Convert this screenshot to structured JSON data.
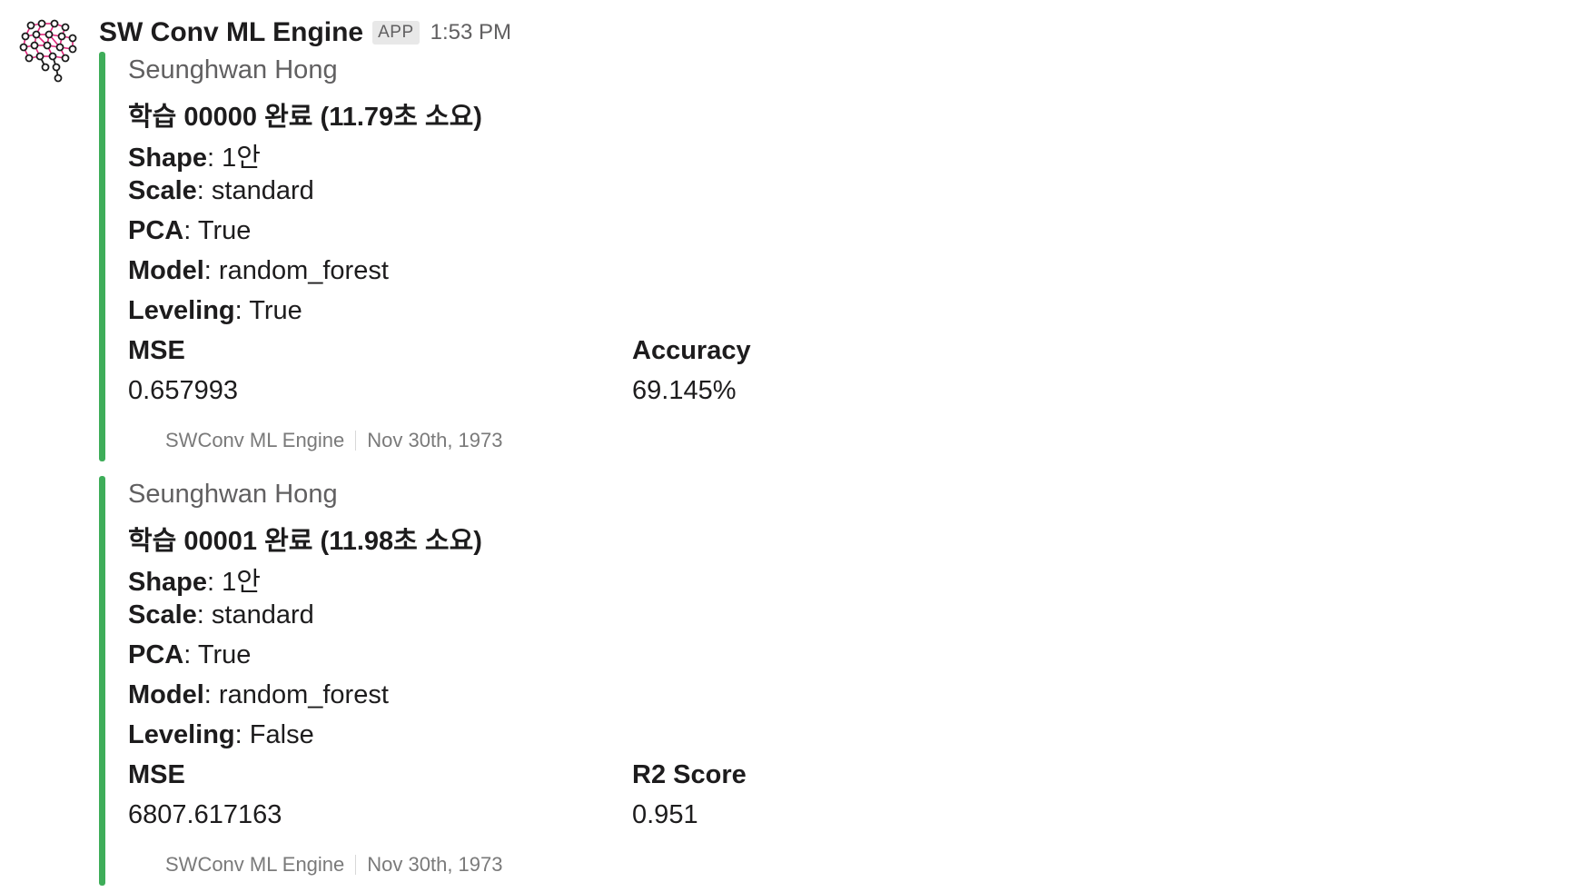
{
  "message": {
    "sender": "SW Conv ML Engine",
    "badge": "APP",
    "time": "1:53 PM",
    "avatar_icon": "neural-network-brain-icon"
  },
  "accent_color": "#3ead59",
  "attachments": [
    {
      "author": "Seunghwan Hong",
      "title": "학습 00000 완료 (11.79초 소요)",
      "fields": [
        {
          "label": "Shape",
          "value": "1안"
        },
        {
          "label": "Scale",
          "value": "standard"
        },
        {
          "label": "PCA",
          "value": "True"
        },
        {
          "label": "Model",
          "value": "random_forest"
        },
        {
          "label": "Leveling",
          "value": "True"
        }
      ],
      "metrics": [
        {
          "label": "MSE",
          "value": "0.657993"
        },
        {
          "label": "Accuracy",
          "value": "69.145%"
        }
      ],
      "footer": "SWConv ML Engine",
      "footer_date": "Nov 30th, 1973"
    },
    {
      "author": "Seunghwan Hong",
      "title": "학습 00001 완료 (11.98초 소요)",
      "fields": [
        {
          "label": "Shape",
          "value": "1안"
        },
        {
          "label": "Scale",
          "value": "standard"
        },
        {
          "label": "PCA",
          "value": "True"
        },
        {
          "label": "Model",
          "value": "random_forest"
        },
        {
          "label": "Leveling",
          "value": "False"
        }
      ],
      "metrics": [
        {
          "label": "MSE",
          "value": "6807.617163"
        },
        {
          "label": "R2 Score",
          "value": "0.951"
        }
      ],
      "footer": "SWConv ML Engine",
      "footer_date": "Nov 30th, 1973"
    }
  ]
}
